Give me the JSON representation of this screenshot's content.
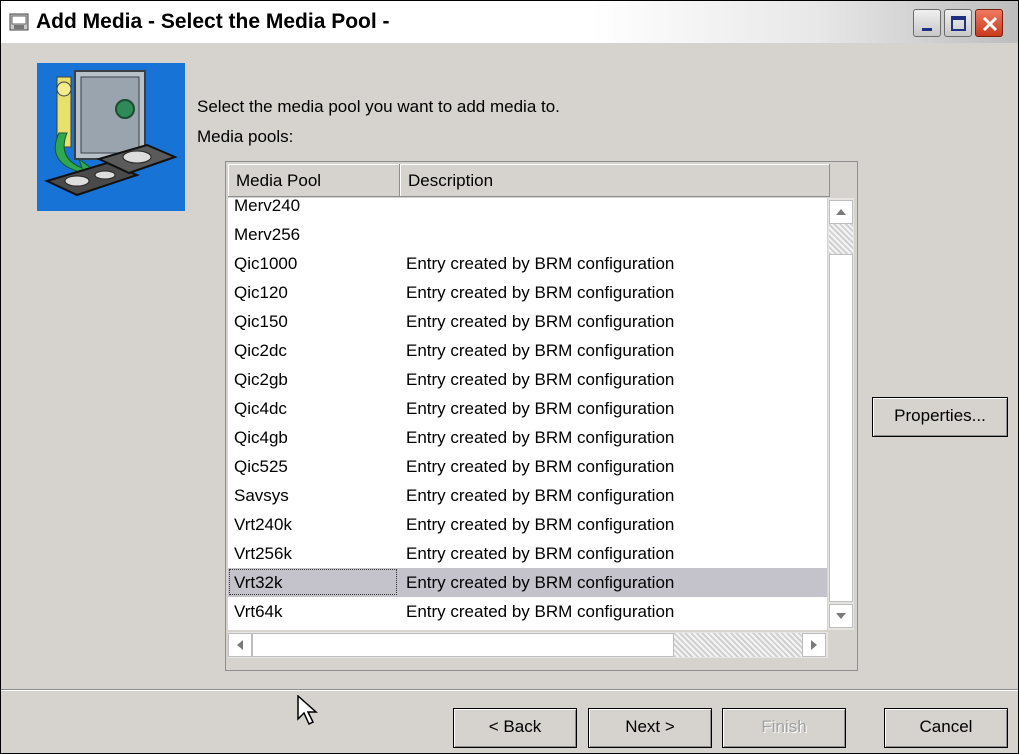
{
  "window": {
    "title": "Add Media - Select the Media Pool -",
    "controls": [
      "minimize-icon",
      "maximize-icon",
      "close-icon"
    ],
    "accent_color": "#1873d6",
    "close_color": "#d9462a"
  },
  "content": {
    "instruction": "Select the media pool you want to add media to.",
    "pools_label": "Media pools:"
  },
  "table": {
    "columns": [
      "Media Pool",
      "Description"
    ],
    "rows": [
      {
        "pool": "Merv240",
        "description": ""
      },
      {
        "pool": "Merv256",
        "description": ""
      },
      {
        "pool": "Qic1000",
        "description": "Entry created by BRM configuration"
      },
      {
        "pool": "Qic120",
        "description": "Entry created by BRM configuration"
      },
      {
        "pool": "Qic150",
        "description": "Entry created by BRM configuration"
      },
      {
        "pool": "Qic2dc",
        "description": "Entry created by BRM configuration"
      },
      {
        "pool": "Qic2gb",
        "description": "Entry created by BRM configuration"
      },
      {
        "pool": "Qic4dc",
        "description": "Entry created by BRM configuration"
      },
      {
        "pool": "Qic4gb",
        "description": "Entry created by BRM configuration"
      },
      {
        "pool": "Qic525",
        "description": "Entry created by BRM configuration"
      },
      {
        "pool": "Savsys",
        "description": "Entry created by BRM configuration"
      },
      {
        "pool": "Vrt240k",
        "description": "Entry created by BRM configuration"
      },
      {
        "pool": "Vrt256k",
        "description": "Entry created by BRM configuration"
      },
      {
        "pool": "Vrt32k",
        "description": "Entry created by BRM configuration"
      },
      {
        "pool": "Vrt64k",
        "description": "Entry created by BRM configuration"
      }
    ],
    "selected_pool": "Vrt32k"
  },
  "buttons": {
    "properties": "Properties...",
    "back": "< Back",
    "next": "Next >",
    "finish": "Finish",
    "cancel": "Cancel"
  }
}
